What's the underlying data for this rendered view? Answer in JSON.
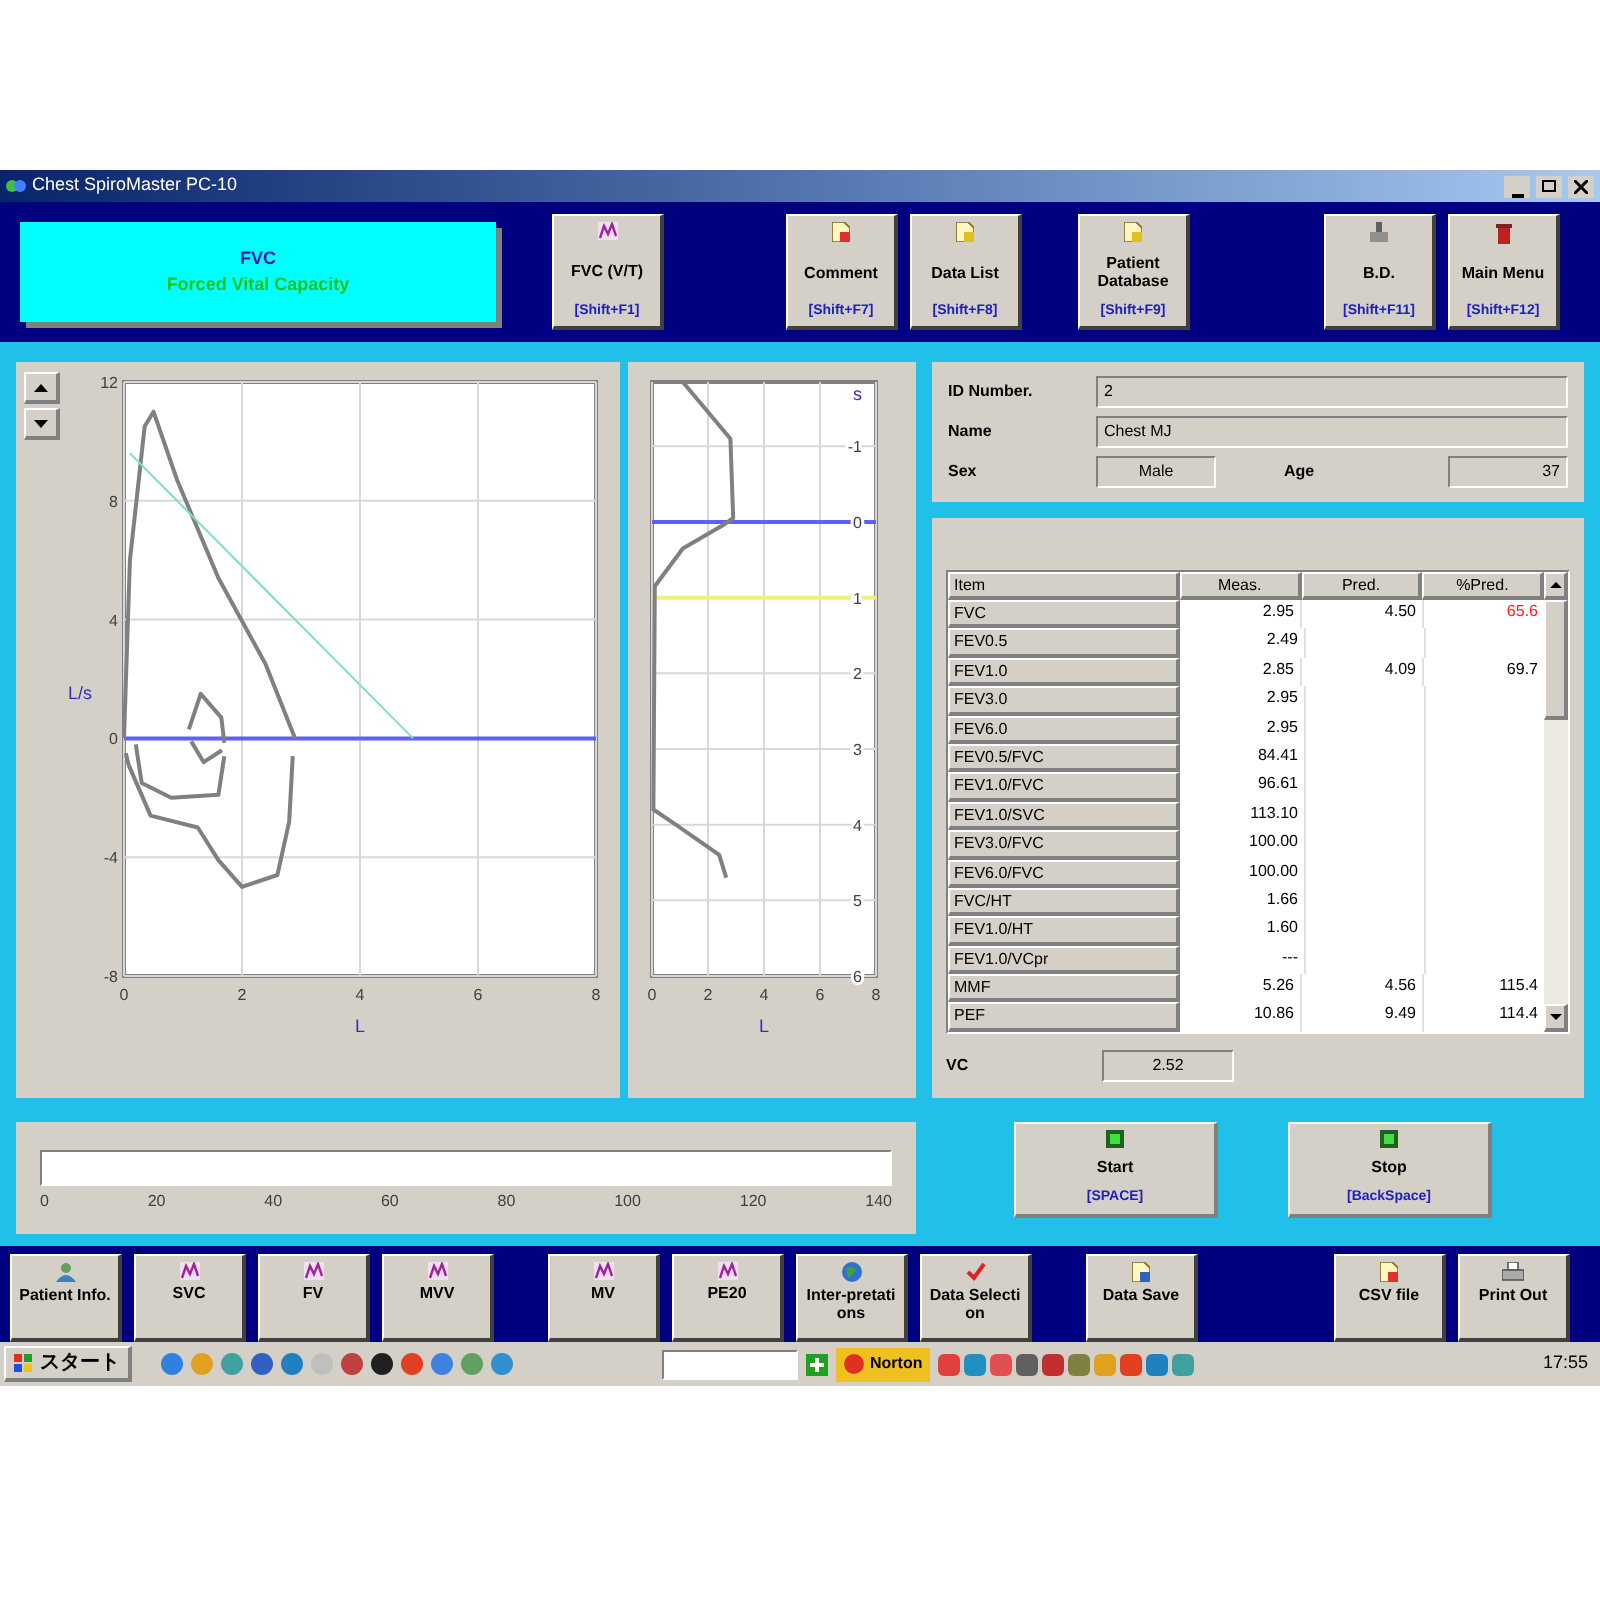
{
  "window": {
    "title": "Chest SpiroMaster PC-10"
  },
  "mode_banner": {
    "title": "FVC",
    "subtitle": "Forced Vital Capacity"
  },
  "top_toolbar": {
    "groups": [
      [
        {
          "label": "FVC (V/T)",
          "shortcut": "[Shift+F1]"
        }
      ],
      [
        {
          "label": "Comment",
          "shortcut": "[Shift+F7]"
        },
        {
          "label": "Data List",
          "shortcut": "[Shift+F8]"
        }
      ],
      [
        {
          "label": "Patient Database",
          "shortcut": "[Shift+F9]"
        }
      ],
      [
        {
          "label": "B.D.",
          "shortcut": "[Shift+F11]"
        },
        {
          "label": "Main Menu",
          "shortcut": "[Shift+F12]"
        }
      ]
    ]
  },
  "flow_volume_chart": {
    "chart_data": {
      "type": "line",
      "xlabel": "L",
      "ylabel": "L/s",
      "xlim": [
        0,
        8
      ],
      "ylim": [
        -8,
        12
      ],
      "xticks": [
        0,
        2,
        4,
        6,
        8
      ],
      "yticks": [
        -8,
        -4,
        0,
        4,
        8,
        12
      ],
      "grid": true,
      "series": [
        {
          "color": "#808080",
          "x": [
            0,
            0.1,
            0.35,
            0.5,
            0.9,
            1.6,
            2.4,
            2.9
          ],
          "values": [
            0,
            6,
            10.5,
            11,
            8.7,
            5.4,
            2.5,
            0
          ]
        },
        {
          "color": "#808080",
          "x": [
            0.03,
            0.08,
            0.45,
            1.25,
            1.6,
            2.0,
            2.6,
            2.8,
            2.86
          ],
          "values": [
            -0.5,
            -0.9,
            -2.6,
            -3,
            -4.1,
            -5,
            -4.6,
            -2.8,
            -0.6
          ]
        },
        {
          "color": "#808080",
          "x": [
            0.2,
            0.3,
            0.8,
            1.6,
            1.7
          ],
          "values": [
            -0.2,
            -1.5,
            -2,
            -1.9,
            -0.6
          ]
        },
        {
          "color": "#808080",
          "x": [
            1.1,
            1.3,
            1.65,
            1.7
          ],
          "values": [
            0.3,
            1.5,
            0.7,
            -0.15
          ]
        },
        {
          "color": "#808080",
          "x": [
            1.14,
            1.35,
            1.66
          ],
          "values": [
            -0.1,
            -0.8,
            -0.4
          ]
        },
        {
          "color": "#80e0c0",
          "x": [
            0.1,
            4.9
          ],
          "values": [
            9.6,
            0
          ]
        }
      ],
      "ref_lines": [
        {
          "axis": "y",
          "value": 0,
          "color": "#6060ff"
        }
      ]
    }
  },
  "volume_time_chart": {
    "chart_data": {
      "type": "line",
      "xlabel": "L",
      "ylabel": "s",
      "xlim": [
        0,
        8
      ],
      "ylim": [
        6,
        -1.85
      ],
      "xticks": [
        0,
        2,
        4,
        6,
        8
      ],
      "yticks": [
        -1,
        0,
        1,
        2,
        3,
        4,
        5,
        6
      ],
      "grid": true,
      "series": [
        {
          "color": "#808080",
          "x": [
            1.1,
            2.8,
            2.9,
            2.5,
            1.1,
            0.1,
            0.05,
            0.85,
            2.4,
            2.65
          ],
          "values": [
            -1.85,
            -1.1,
            -0.05,
            0.05,
            0.35,
            0.85,
            3.8,
            4.0,
            4.4,
            4.7
          ]
        }
      ],
      "ref_lines": [
        {
          "axis": "y",
          "value": 0,
          "color": "#6060ff"
        },
        {
          "axis": "y",
          "value": 1,
          "color": "#f0f080"
        }
      ]
    }
  },
  "patient": {
    "fields": [
      {
        "label": "ID Number.",
        "value": "2"
      },
      {
        "label": "Name",
        "value": "Chest MJ"
      }
    ],
    "sex": {
      "label": "Sex",
      "value": "Male"
    },
    "age": {
      "label": "Age",
      "value": "37"
    }
  },
  "results_table": {
    "columns": [
      "Item",
      "Meas.",
      "Pred.",
      "%Pred."
    ],
    "rows": [
      {
        "item": "FVC",
        "meas": "2.95",
        "pred": "4.50",
        "pct_pred": "65.6",
        "alert": true
      },
      {
        "item": "FEV0.5",
        "meas": "2.49"
      },
      {
        "item": "FEV1.0",
        "meas": "2.85",
        "pred": "4.09",
        "pct_pred": "69.7",
        "alert": false
      },
      {
        "item": "FEV3.0",
        "meas": "2.95"
      },
      {
        "item": "FEV6.0",
        "meas": "2.95"
      },
      {
        "item": "FEV0.5/FVC",
        "meas": "84.41"
      },
      {
        "item": "FEV1.0/FVC",
        "meas": "96.61"
      },
      {
        "item": "FEV1.0/SVC",
        "meas": "113.10"
      },
      {
        "item": "FEV3.0/FVC",
        "meas": "100.00"
      },
      {
        "item": "FEV6.0/FVC",
        "meas": "100.00"
      },
      {
        "item": "FVC/HT",
        "meas": "1.66"
      },
      {
        "item": "FEV1.0/HT",
        "meas": "1.60"
      },
      {
        "item": "FEV1.0/VCpr",
        "meas": "---"
      },
      {
        "item": "MMF",
        "meas": "5.26",
        "pred": "4.56",
        "pct_pred": "115.4",
        "alert": false
      },
      {
        "item": "PEF",
        "meas": "10.86",
        "pred": "9.49",
        "pct_pred": "114.4",
        "alert": false
      }
    ]
  },
  "vc": {
    "label": "VC",
    "value": "2.52"
  },
  "progress": {
    "level": 0,
    "ticks": [
      "0",
      "20",
      "40",
      "60",
      "80",
      "100",
      "120",
      "140"
    ]
  },
  "actions": [
    {
      "label": "Start",
      "shortcut": "[SPACE]"
    },
    {
      "label": "Stop",
      "shortcut": "[BackSpace]"
    }
  ],
  "bottom_toolbar": {
    "groups": [
      [
        {
          "label": "Patient Info."
        },
        {
          "label": "SVC"
        },
        {
          "label": "FV"
        },
        {
          "label": "MVV"
        }
      ],
      [
        {
          "label": "MV"
        },
        {
          "label": "PE20"
        },
        {
          "label": "Inter-pretations"
        },
        {
          "label": "Data Selection"
        }
      ],
      [
        {
          "label": "Data Save"
        }
      ],
      [
        {
          "label": "CSV file"
        },
        {
          "label": "Print Out"
        }
      ]
    ]
  },
  "taskbar": {
    "start_label": "スタート",
    "norton_label": "Norton",
    "clock": "17:55"
  }
}
